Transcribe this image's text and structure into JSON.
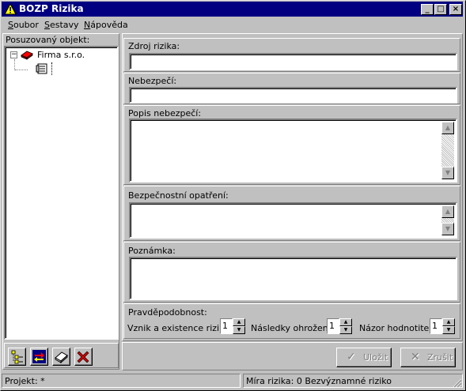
{
  "window": {
    "title": "BOZP Rizika",
    "minimize": "_",
    "maximize": "□",
    "close": "×"
  },
  "menu": {
    "soubor": {
      "first": "S",
      "rest": "oubor"
    },
    "sestavy": {
      "first": "S",
      "rest": "estavy"
    },
    "napoveda": {
      "first": "N",
      "rest": "ápověda"
    }
  },
  "tree": {
    "label": "Posuzovaný objekt:",
    "expander": "−",
    "root": "Firma s.r.o."
  },
  "form": {
    "zdroj_label": "Zdroj rizika:",
    "zdroj_value": "",
    "nebezpeci_label": "Nebezpečí:",
    "nebezpeci_value": "",
    "popis_label": "Popis nebezpečí:",
    "bezpecnostni_label": "Bezpečnostní opatření:",
    "poznamka_label": "Poznámka:",
    "pravdepodobnost_label": "Pravděpodobnost:",
    "vznik_label": "Vznik a existence rizika:",
    "vznik_value": "1",
    "nasledky_label": "Následky ohrožení:",
    "nasledky_value": "1",
    "nazor_label": "Názor hodnotitele:",
    "nazor_value": "1"
  },
  "actions": {
    "save_label": "Uložit",
    "cancel_label": "Zrušit"
  },
  "status": {
    "project": "Projekt:  *",
    "risk": "Míra rizika: 0 Bezvýznamné riziko"
  },
  "colors": {
    "titlebar": "#000080",
    "face": "#c0c0c0",
    "close_x": "#cc0000"
  }
}
